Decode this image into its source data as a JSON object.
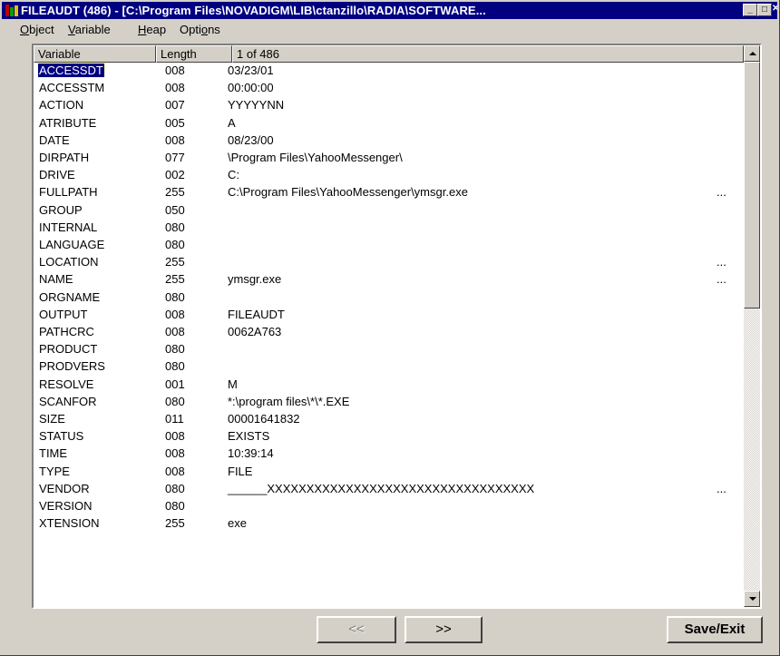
{
  "window": {
    "title": "FILEAUDT (486) - [C:\\Program Files\\NOVADIGM\\LIB\\ctanzillo\\RADIA\\SOFTWARE...",
    "minimize": "_",
    "maximize": "□",
    "close": "✕"
  },
  "menu": {
    "object": {
      "u": "O",
      "rest": "bject"
    },
    "variable": {
      "u": "V",
      "rest": "ariable"
    },
    "heap": {
      "u": "H",
      "rest": "eap"
    },
    "options": {
      "pre": "Opti",
      "u": "o",
      "rest": "ns"
    }
  },
  "table": {
    "headers": {
      "variable": "Variable",
      "length": "Length",
      "value": "1 of 486"
    },
    "rows": [
      {
        "name": "ACCESSDT",
        "len": "008",
        "value": "03/23/01",
        "more": ""
      },
      {
        "name": "ACCESSTM",
        "len": "008",
        "value": "00:00:00",
        "more": ""
      },
      {
        "name": "ACTION",
        "len": "007",
        "value": "YYYYYNN",
        "more": ""
      },
      {
        "name": "ATRIBUTE",
        "len": "005",
        "value": "A",
        "more": ""
      },
      {
        "name": "DATE",
        "len": "008",
        "value": "08/23/00",
        "more": ""
      },
      {
        "name": "DIRPATH",
        "len": "077",
        "value": "\\Program Files\\YahooMessenger\\",
        "more": ""
      },
      {
        "name": "DRIVE",
        "len": "002",
        "value": "C:",
        "more": ""
      },
      {
        "name": "FULLPATH",
        "len": "255",
        "value": "C:\\Program Files\\YahooMessenger\\ymsgr.exe",
        "more": "..."
      },
      {
        "name": "GROUP",
        "len": "050",
        "value": "",
        "more": ""
      },
      {
        "name": "INTERNAL",
        "len": "080",
        "value": "",
        "more": ""
      },
      {
        "name": "LANGUAGE",
        "len": "080",
        "value": "",
        "more": ""
      },
      {
        "name": "LOCATION",
        "len": "255",
        "value": "",
        "more": "..."
      },
      {
        "name": "NAME",
        "len": "255",
        "value": "ymsgr.exe",
        "more": "..."
      },
      {
        "name": "ORGNAME",
        "len": "080",
        "value": "",
        "more": ""
      },
      {
        "name": "OUTPUT",
        "len": "008",
        "value": "FILEAUDT",
        "more": ""
      },
      {
        "name": "PATHCRC",
        "len": "008",
        "value": "0062A763",
        "more": ""
      },
      {
        "name": "PRODUCT",
        "len": "080",
        "value": "",
        "more": ""
      },
      {
        "name": "PRODVERS",
        "len": "080",
        "value": "",
        "more": ""
      },
      {
        "name": "RESOLVE",
        "len": "001",
        "value": "M",
        "more": ""
      },
      {
        "name": "SCANFOR",
        "len": "080",
        "value": "*:\\program files\\*\\*.EXE",
        "more": ""
      },
      {
        "name": "SIZE",
        "len": "011",
        "value": "00001641832",
        "more": ""
      },
      {
        "name": "STATUS",
        "len": "008",
        "value": "EXISTS",
        "more": ""
      },
      {
        "name": "TIME",
        "len": "008",
        "value": "10:39:14",
        "more": ""
      },
      {
        "name": "TYPE",
        "len": "008",
        "value": "FILE",
        "more": ""
      },
      {
        "name": "VENDOR",
        "len": "080",
        "value": "______XXXXXXXXXXXXXXXXXXXXXXXXXXXXXXXXXX",
        "more": "..."
      },
      {
        "name": "VERSION",
        "len": "080",
        "value": "",
        "more": ""
      },
      {
        "name": "XTENSION",
        "len": "255",
        "value": "exe",
        "more": ""
      }
    ]
  },
  "buttons": {
    "prev": "<<",
    "next": ">>",
    "save": "Save/Exit"
  }
}
